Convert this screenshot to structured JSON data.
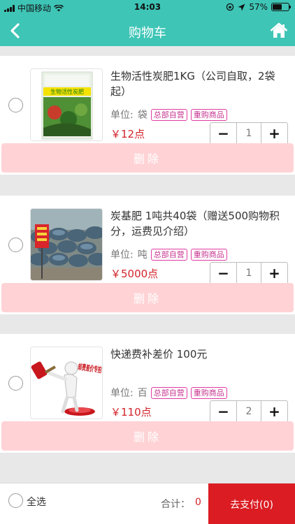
{
  "status_bar": {
    "carrier": "中国移动",
    "time": "14:03",
    "battery": "57%",
    "battery_level": 0.57
  },
  "header": {
    "title": "购物车"
  },
  "tags": {
    "self_run": "总部自营",
    "repurchase": "重购商品"
  },
  "unit_label": "单位:",
  "items": [
    {
      "name": "生物活性炭肥1KG（公司自取，2袋起）",
      "unit": "袋",
      "price": "￥12点",
      "quantity": "1",
      "delete_label": "删除"
    },
    {
      "name": "炭基肥 1吨共40袋（赠送500购物积分，运费见介绍）",
      "unit": "吨",
      "price": "￥5000点",
      "quantity": "1",
      "delete_label": "删除"
    },
    {
      "name": "快递费补差价 100元",
      "unit": "百",
      "price": "￥110点",
      "quantity": "2",
      "delete_label": "删除"
    }
  ],
  "thumb_text": {
    "bag_title": "生物活性炭肥",
    "stamp": "邮费差价专拍"
  },
  "footer": {
    "select_all": "全选",
    "total_label": "合计：",
    "total_value": "0",
    "pay_label": "去支付(0)"
  }
}
